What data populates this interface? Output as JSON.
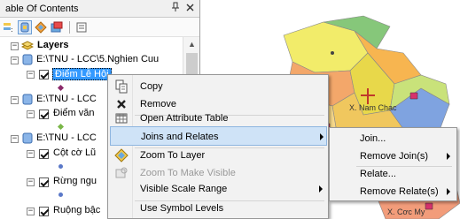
{
  "toc": {
    "title": "able Of Contents",
    "pin_glyph": "ₕ",
    "close_glyph": "✕",
    "layers_root": "Layers",
    "groups": [
      {
        "path": "E:\\TNU - LCC\\5.Nghien Cuu",
        "layer": "Điểm Lễ Hội"
      },
      {
        "path": "E:\\TNU - LCC",
        "layer": "Điểm văn"
      },
      {
        "path": "E:\\TNU - LCC",
        "layer": "Cột cờ Lũ"
      }
    ],
    "extra_layers": [
      "Rừng ngu",
      "Ruộng bậc"
    ]
  },
  "context_menu": {
    "items": [
      {
        "label": "Copy",
        "icon": "copy-icon"
      },
      {
        "label": "Remove",
        "icon": "remove-icon"
      },
      {
        "label": "Open Attribute Table",
        "icon": "table-icon"
      },
      {
        "label": "Joins and Relates",
        "icon": ""
      },
      {
        "label": "Zoom To Layer",
        "icon": "zoom-to-layer-icon"
      },
      {
        "label": "Zoom To Make Visible",
        "icon": "zoom-visible-icon"
      },
      {
        "label": "Visible Scale Range",
        "icon": ""
      },
      {
        "label": "Use Symbol Levels",
        "icon": ""
      }
    ]
  },
  "submenu": {
    "items": [
      "Join...",
      "Remove Join(s)",
      "Relate...",
      "Remove Relate(s)"
    ]
  },
  "map": {
    "labels": [
      "X. Nam Chac",
      "X. Cơc My"
    ]
  },
  "colors": {
    "selection": "#3399ff",
    "menu_highlight": "#cfe3f7",
    "map_yellow": "#f2ec6a",
    "map_orange": "#f7b550",
    "map_green": "#86c77a",
    "map_blue": "#7fa3e0"
  }
}
